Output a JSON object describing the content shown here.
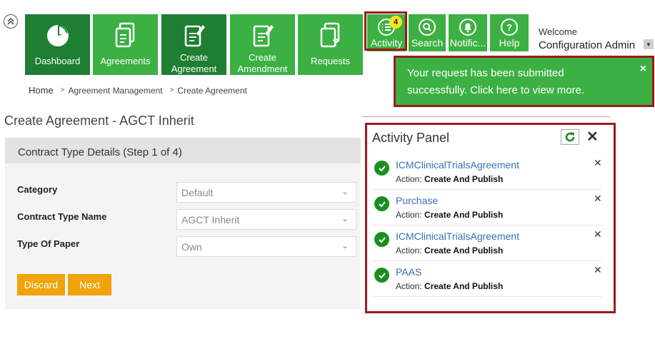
{
  "nav": {
    "tiles": [
      {
        "label": "Dashboard"
      },
      {
        "label": "Agreements"
      },
      {
        "label": "Create Agreement",
        "line1": "Create",
        "line2": "Agreement"
      },
      {
        "label": "Create Amendment",
        "line1": "Create",
        "line2": "Amendment"
      },
      {
        "label": "Requests"
      }
    ],
    "small_tiles": [
      {
        "label": "Activity",
        "badge": "4"
      },
      {
        "label": "Search"
      },
      {
        "label": "Notific..."
      },
      {
        "label": "Help"
      }
    ],
    "welcome": "Welcome",
    "user_name": "Configuration Admin"
  },
  "toast": {
    "message_line1": "Your request has been submitted",
    "message_line2": "successfully. Click here to view more.",
    "close": "×"
  },
  "breadcrumb": {
    "home": "Home",
    "items": [
      "Agreement Management",
      "Create Agreement"
    ],
    "separator": ">"
  },
  "page": {
    "title": "Create Agreement - AGCT Inherit"
  },
  "form": {
    "header": "Contract Type Details (Step 1 of 4)",
    "fields": [
      {
        "label": "Category",
        "value": "Default"
      },
      {
        "label": "Contract Type Name",
        "value": "AGCT Inherit"
      },
      {
        "label": "Type Of Paper",
        "value": "Own"
      }
    ],
    "discard_label": "Discard",
    "next_label": "Next"
  },
  "activity_panel": {
    "title": "Activity Panel",
    "close": "✕",
    "items": [
      {
        "name": "ICMClinicalTrialsAgreement",
        "action_label": "Action:",
        "action_value": "Create And Publish"
      },
      {
        "name": "Purchase",
        "action_label": "Action:",
        "action_value": "Create And Publish"
      },
      {
        "name": "ICMClinicalTrialsAgreement",
        "action_label": "Action:",
        "action_value": "Create And Publish"
      },
      {
        "name": "PAAS",
        "action_label": "Action:",
        "action_value": "Create And Publish"
      }
    ]
  },
  "colors": {
    "tile_dark": "#1e7e32",
    "tile_light": "#3cb043",
    "highlight_border": "#9b1b1b",
    "button_orange": "#f0a30a",
    "link_blue": "#3a6fb5",
    "badge_yellow": "#f6e520"
  }
}
